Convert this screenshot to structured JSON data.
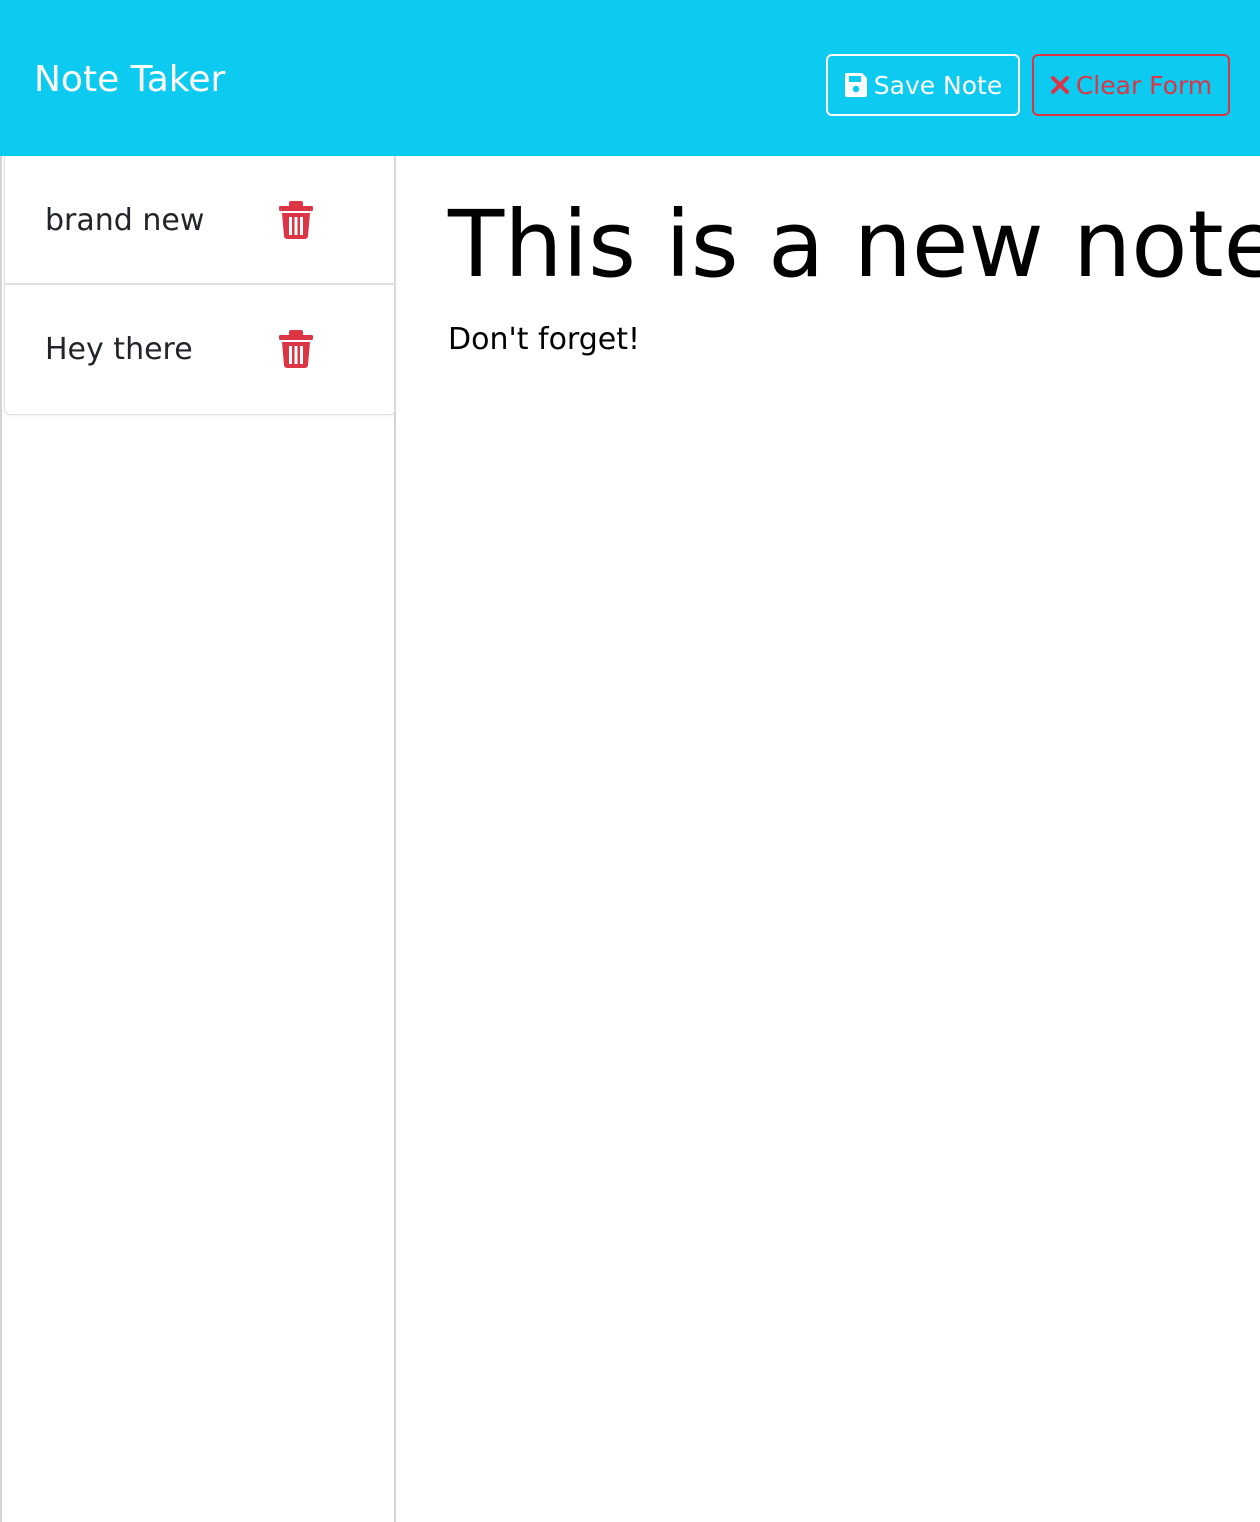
{
  "app": {
    "brand": "Note Taker",
    "accent_color": "#0dcaf0",
    "danger_color": "#dc3545"
  },
  "toolbar": {
    "save_label": "Save Note",
    "save_icon": "save-icon",
    "clear_label": "Clear Form",
    "clear_icon": "close-icon"
  },
  "sidebar": {
    "notes": [
      {
        "title": "brand new",
        "delete_icon": "trash-icon"
      },
      {
        "title": "Hey there",
        "delete_icon": "trash-icon"
      }
    ]
  },
  "editor": {
    "title": "This is a new note",
    "text": "Don't forget!"
  }
}
